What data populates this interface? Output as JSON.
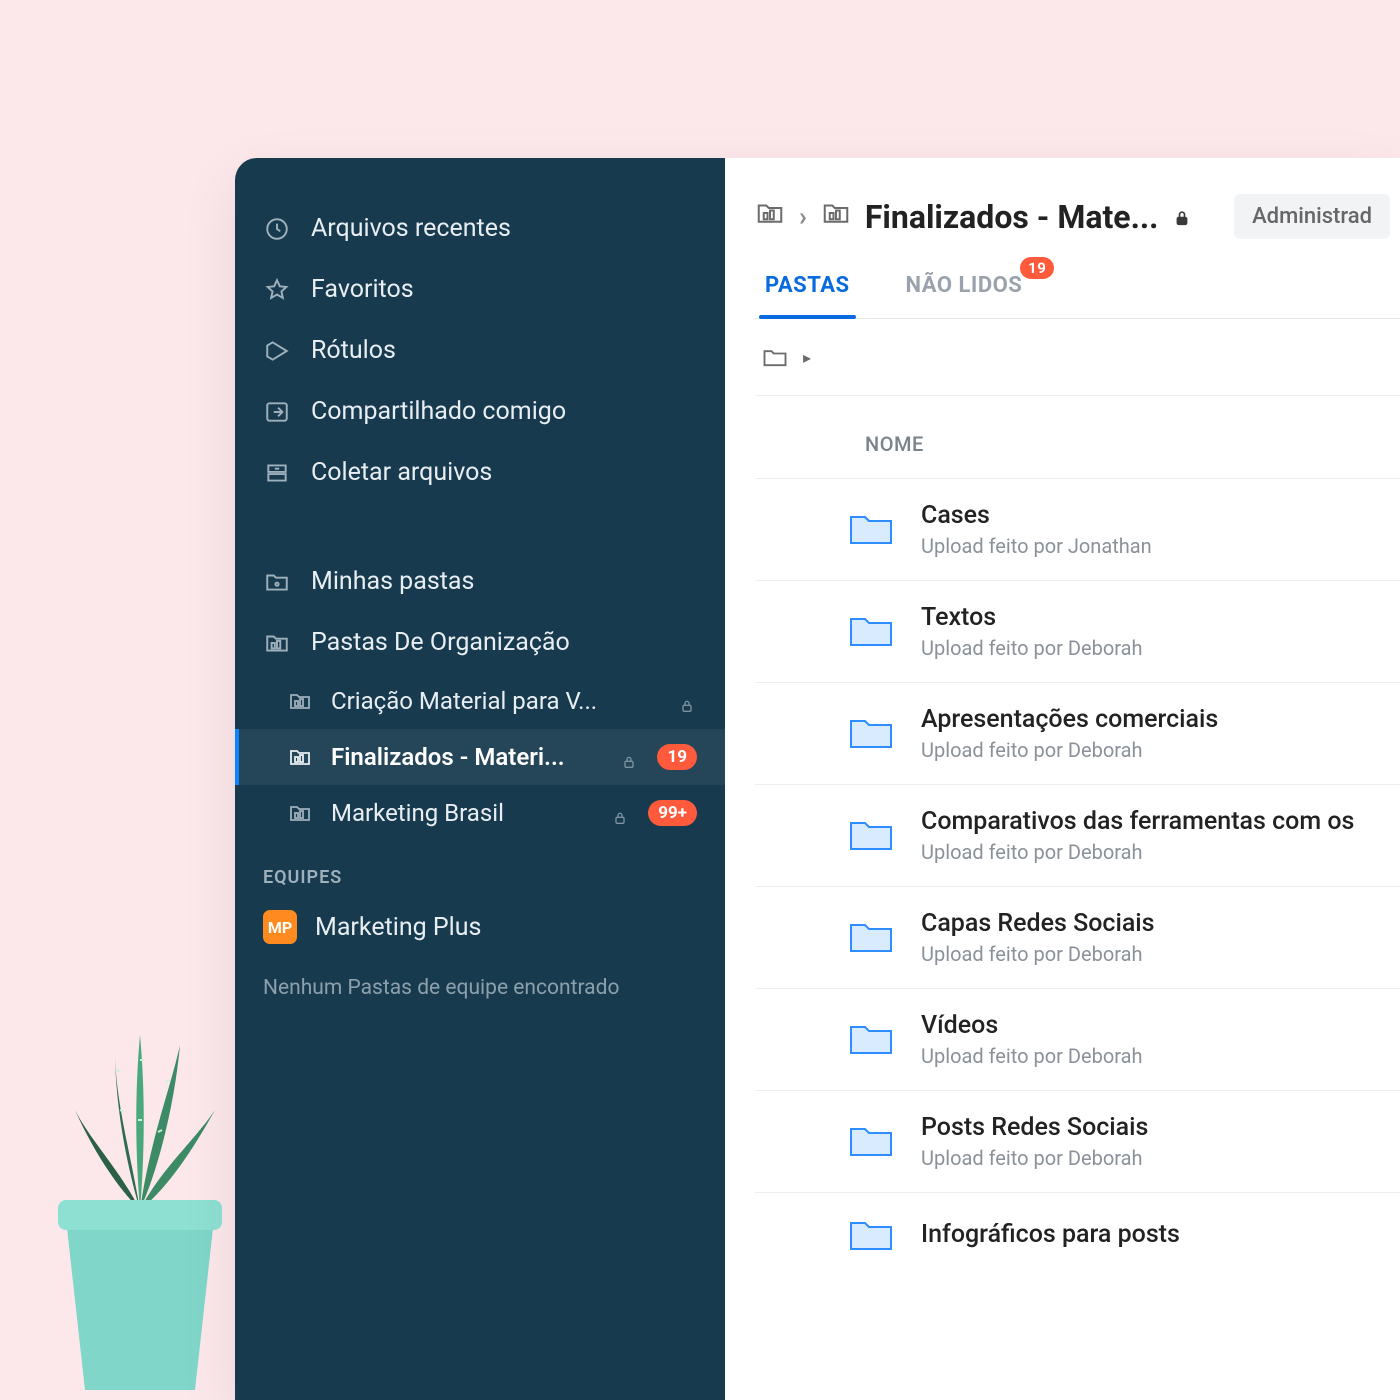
{
  "sidebar": {
    "nav": [
      {
        "label": "Arquivos recentes"
      },
      {
        "label": "Favoritos"
      },
      {
        "label": "Rótulos"
      },
      {
        "label": "Compartilhado comigo"
      },
      {
        "label": "Coletar arquivos"
      }
    ],
    "folders_section": [
      {
        "label": "Minhas pastas"
      },
      {
        "label": "Pastas De Organização"
      }
    ],
    "org_children": [
      {
        "label": "Criação Material para V...",
        "locked": true,
        "badge": null
      },
      {
        "label": "Finalizados - Materi...",
        "locked": true,
        "badge": "19",
        "active": true
      },
      {
        "label": "Marketing Brasil",
        "locked": true,
        "badge": "99+"
      }
    ],
    "teams_header": "EQUIPES",
    "team": {
      "initials": "MP",
      "name": "Marketing Plus"
    },
    "empty_team_msg": "Nenhum Pastas de equipe encontrado"
  },
  "main": {
    "breadcrumb_title": "Finalizados - Mate...",
    "role_chip": "Administrad",
    "tabs": {
      "folders": "PASTAS",
      "unread": "NÃO LIDOS",
      "unread_badge": "19"
    },
    "list_header": "NOME",
    "rows": [
      {
        "name": "Cases",
        "sub": "Upload feito por Jonathan"
      },
      {
        "name": "Textos",
        "sub": "Upload feito por Deborah"
      },
      {
        "name": "Apresentações comerciais",
        "sub": "Upload feito por Deborah"
      },
      {
        "name": "Comparativos das ferramentas com os",
        "sub": "Upload feito por Deborah"
      },
      {
        "name": "Capas Redes Sociais",
        "sub": "Upload feito por Deborah"
      },
      {
        "name": "Vídeos",
        "sub": "Upload feito por Deborah"
      },
      {
        "name": "Posts Redes Sociais",
        "sub": "Upload feito por Deborah"
      },
      {
        "name": "Infográficos para posts",
        "sub": ""
      }
    ]
  }
}
